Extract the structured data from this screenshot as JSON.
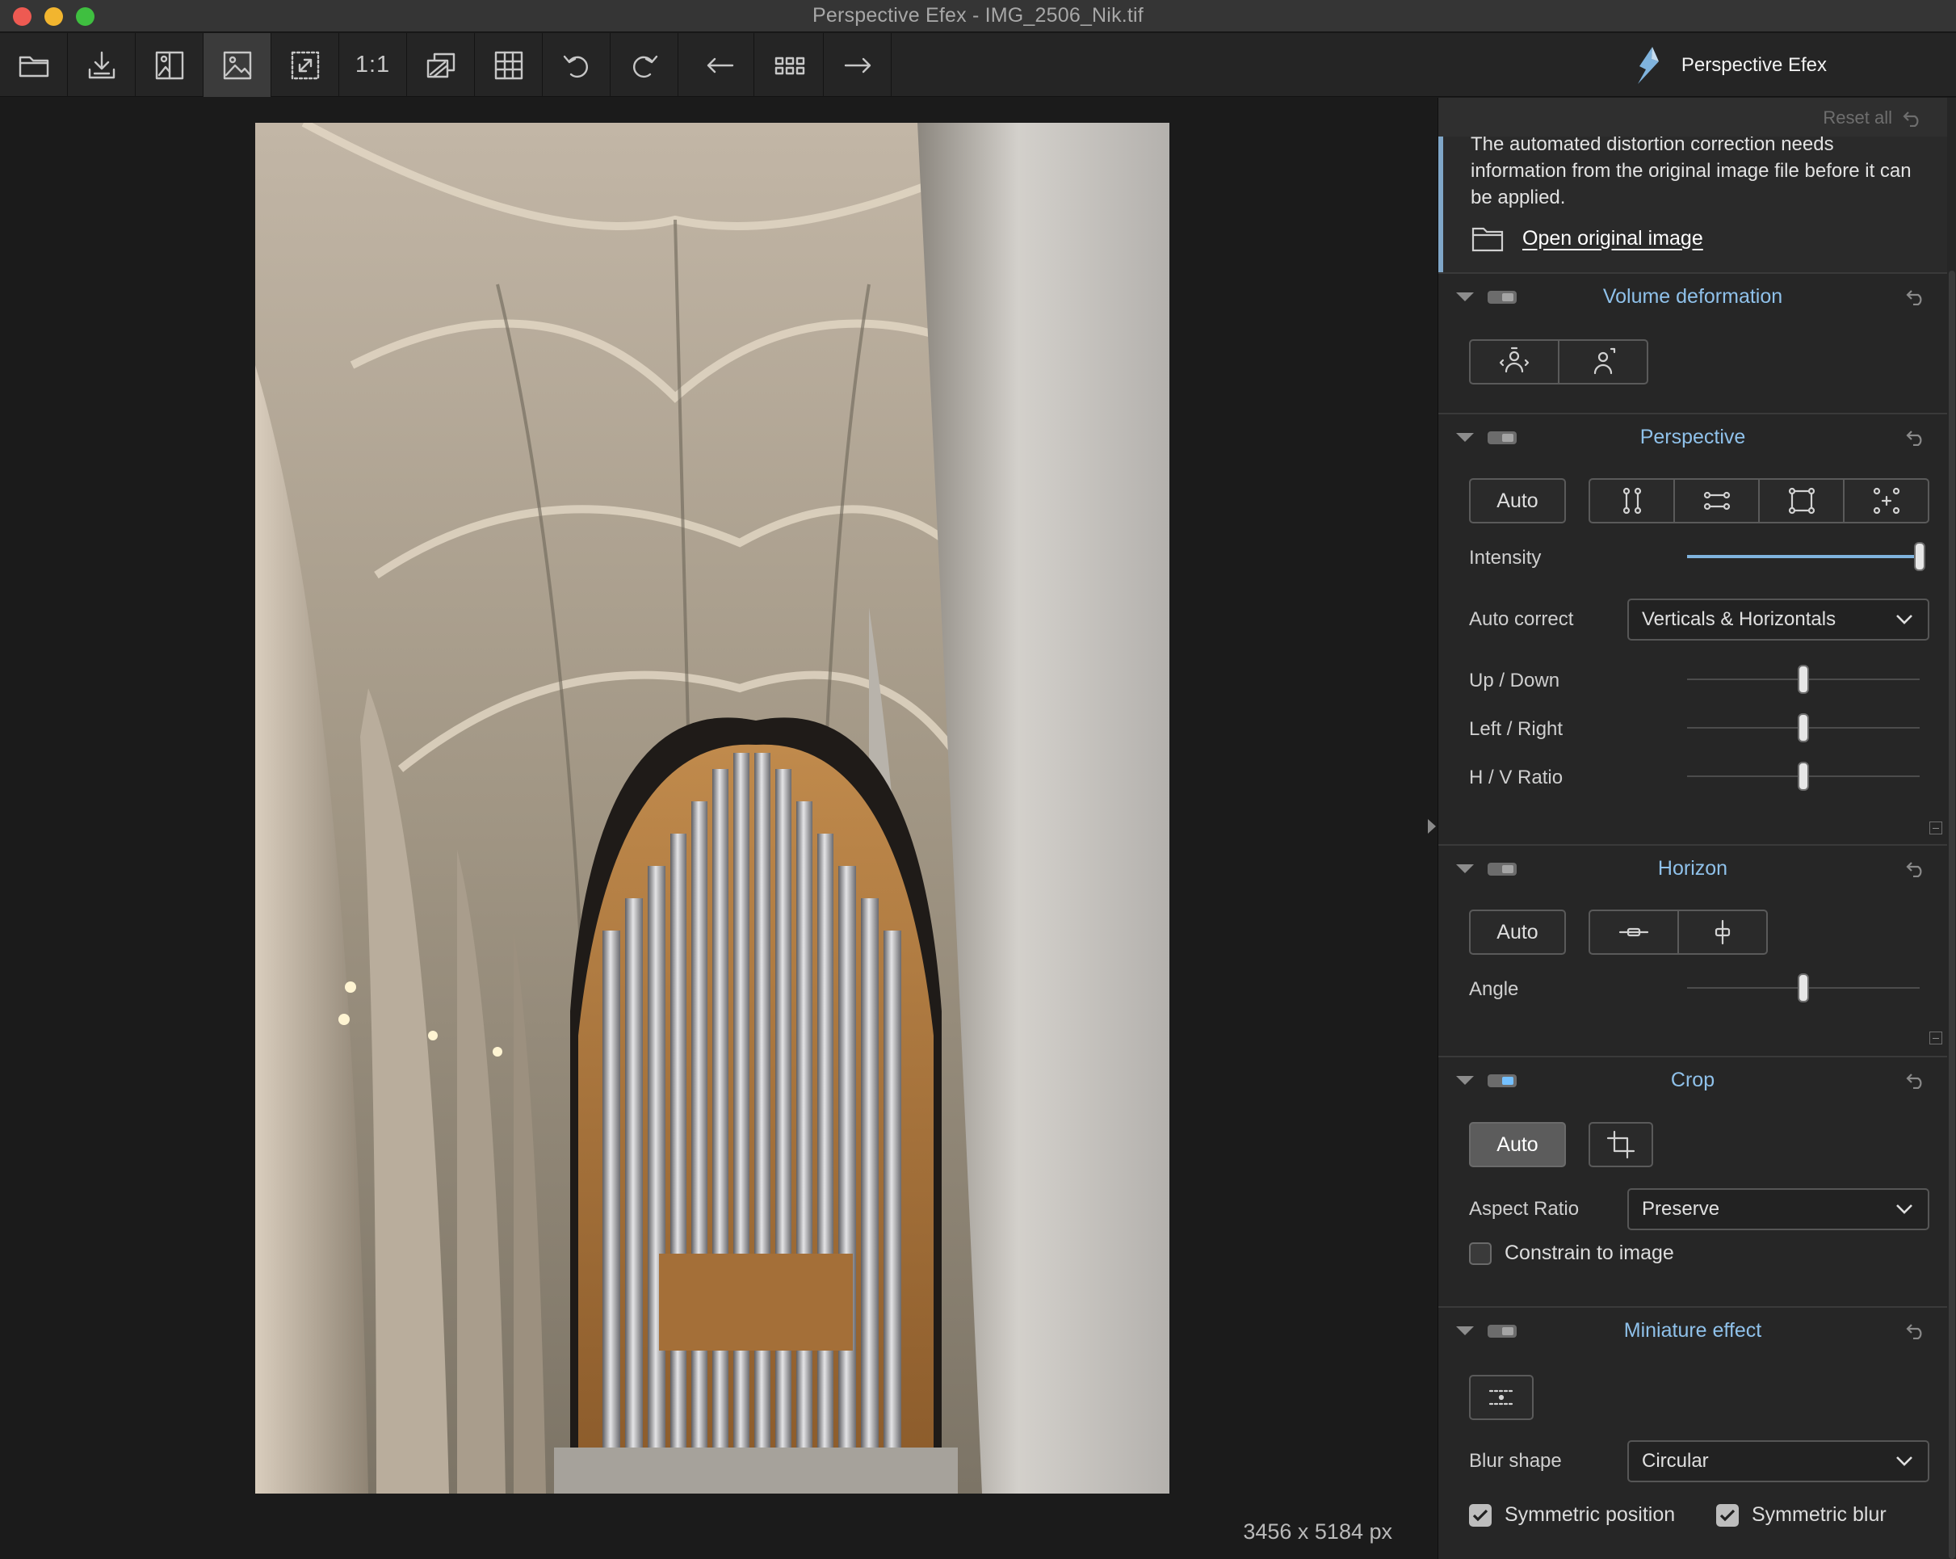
{
  "window": {
    "title": "Perspective Efex - IMG_2506_Nik.tif"
  },
  "toolbar": {
    "buttons": [
      {
        "id": "open",
        "icon": "folder-icon"
      },
      {
        "id": "save",
        "icon": "download-icon"
      },
      {
        "id": "compare",
        "icon": "image-compare-icon"
      },
      {
        "id": "preview",
        "icon": "image-icon",
        "active": true
      },
      {
        "id": "fit",
        "icon": "expand-icon"
      },
      {
        "id": "zoom_1_1",
        "label": "1:1"
      },
      {
        "id": "loupe",
        "icon": "layers-icon"
      },
      {
        "id": "grid",
        "icon": "grid-icon"
      },
      {
        "id": "undo",
        "icon": "undo-icon"
      },
      {
        "id": "redo",
        "icon": "redo-icon"
      },
      {
        "id": "previous",
        "icon": "arrow-left-icon"
      },
      {
        "id": "filmstrip",
        "icon": "thumbnails-icon"
      },
      {
        "id": "next",
        "icon": "arrow-right-icon"
      }
    ],
    "brand": "Perspective Efex"
  },
  "canvas": {
    "image_size": "3456 x 5184 px"
  },
  "panel": {
    "reset_all": "Reset all",
    "notice": {
      "message": "The automated distortion correction needs information from the original image file before it can be applied.",
      "open_link": "Open original image"
    },
    "volume": {
      "title": "Volume deformation"
    },
    "perspective": {
      "title": "Perspective",
      "auto": "Auto",
      "intensity_label": "Intensity",
      "intensity_value": 1.0,
      "auto_correct_label": "Auto correct",
      "auto_correct_value": "Verticals & Horizontals",
      "up_down_label": "Up / Down",
      "up_down_value": 0.5,
      "left_right_label": "Left / Right",
      "left_right_value": 0.5,
      "hv_ratio_label": "H / V Ratio",
      "hv_ratio_value": 0.5
    },
    "horizon": {
      "title": "Horizon",
      "auto": "Auto",
      "angle_label": "Angle",
      "angle_value": 0.5
    },
    "crop": {
      "title": "Crop",
      "auto": "Auto",
      "aspect_label": "Aspect Ratio",
      "aspect_value": "Preserve",
      "constrain_label": "Constrain to image",
      "constrain_checked": false
    },
    "miniature": {
      "title": "Miniature effect",
      "blur_shape_label": "Blur shape",
      "blur_shape_value": "Circular",
      "sym_position_label": "Symmetric position",
      "sym_position_checked": true,
      "sym_blur_label": "Symmetric blur",
      "sym_blur_checked": true
    }
  },
  "colors": {
    "accent": "#8fc1ea",
    "notice_bar": "#7fa6c8",
    "slider_fill": "#7fb3dd"
  }
}
